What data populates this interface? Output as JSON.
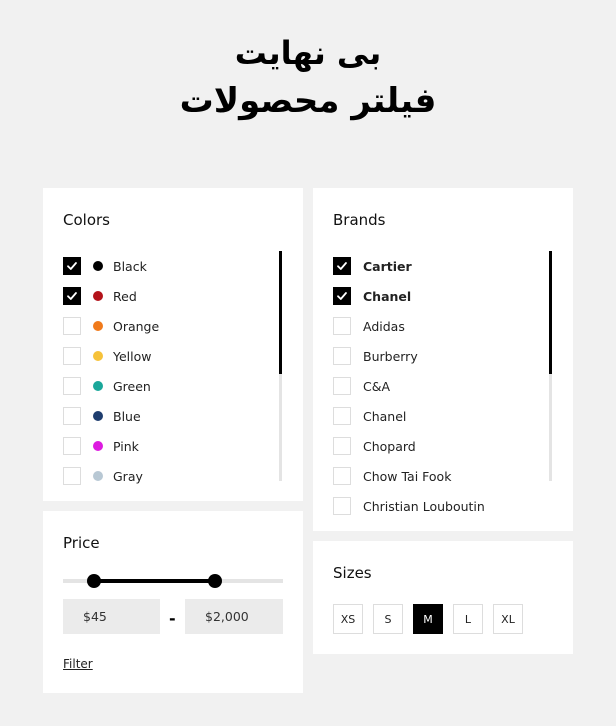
{
  "header": {
    "line1": "بی نهایت",
    "line2": "فیلتر محصولات"
  },
  "colors": {
    "title": "Colors",
    "items": [
      {
        "label": "Black",
        "color": "#000000",
        "checked": true
      },
      {
        "label": "Red",
        "color": "#b3121a",
        "checked": true
      },
      {
        "label": "Orange",
        "color": "#f07a1b",
        "checked": false
      },
      {
        "label": "Yellow",
        "color": "#f6c23a",
        "checked": false
      },
      {
        "label": "Green",
        "color": "#1aa79a",
        "checked": false
      },
      {
        "label": "Blue",
        "color": "#1e3d6e",
        "checked": false
      },
      {
        "label": "Pink",
        "color": "#dd1be0",
        "checked": false
      },
      {
        "label": "Gray",
        "color": "#b8c8d4",
        "checked": false
      }
    ]
  },
  "brands": {
    "title": "Brands",
    "items": [
      {
        "label": "Cartier",
        "checked": true
      },
      {
        "label": "Chanel",
        "checked": true
      },
      {
        "label": "Adidas",
        "checked": false
      },
      {
        "label": "Burberry",
        "checked": false
      },
      {
        "label": "C&A",
        "checked": false
      },
      {
        "label": "Chanel",
        "checked": false
      },
      {
        "label": "Chopard",
        "checked": false
      },
      {
        "label": "Chow Tai Fook",
        "checked": false
      },
      {
        "label": "Christian Louboutin",
        "checked": false
      }
    ]
  },
  "price": {
    "title": "Price",
    "min": "$45",
    "max": "$2,000",
    "dash": "-",
    "filter_label": "Filter"
  },
  "sizes": {
    "title": "Sizes",
    "items": [
      {
        "label": "XS",
        "selected": false
      },
      {
        "label": "S",
        "selected": false
      },
      {
        "label": "M",
        "selected": true
      },
      {
        "label": "L",
        "selected": false
      },
      {
        "label": "XL",
        "selected": false
      }
    ]
  }
}
